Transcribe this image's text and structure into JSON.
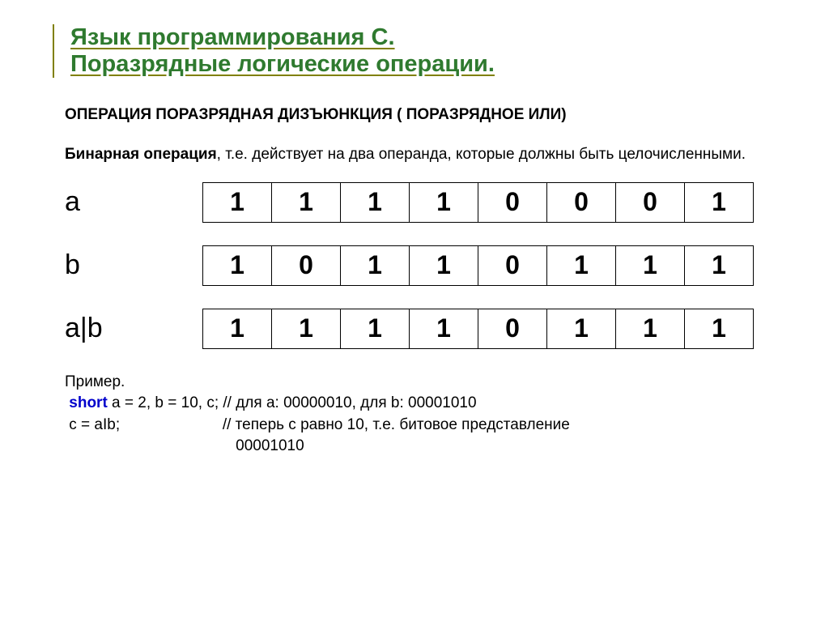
{
  "title": {
    "line1": "Язык программирования С.",
    "line2": " Поразрядные логические операции."
  },
  "subtitle": "ОПЕРАЦИЯ ПОРАЗРЯДНАЯ ДИЗЪЮНКЦИЯ ( ПОРАЗРЯДНОЕ ИЛИ)",
  "desc_bold": "Бинарная операция",
  "desc_rest": ", т.е. действует на два операнда, которые должны быть целочисленными.",
  "rows": {
    "a_label": "a",
    "b_label": "b",
    "ab_label": "a|b",
    "a": [
      "1",
      "1",
      "1",
      "1",
      "0",
      "0",
      "0",
      "1"
    ],
    "b": [
      "1",
      "0",
      "1",
      "1",
      "0",
      "1",
      "1",
      "1"
    ],
    "ab": [
      "1",
      "1",
      "1",
      "1",
      "0",
      "1",
      "1",
      "1"
    ]
  },
  "example": {
    "label": "Пример.",
    "short_kw": "short",
    "line1_rest": " a = 2, b = 10, c; // для a: 00000010, для b: 00001010",
    "line2": " c = aIb;                        // теперь c равно 10, т.е. битовое представление",
    "line3": "                                        00001010"
  }
}
